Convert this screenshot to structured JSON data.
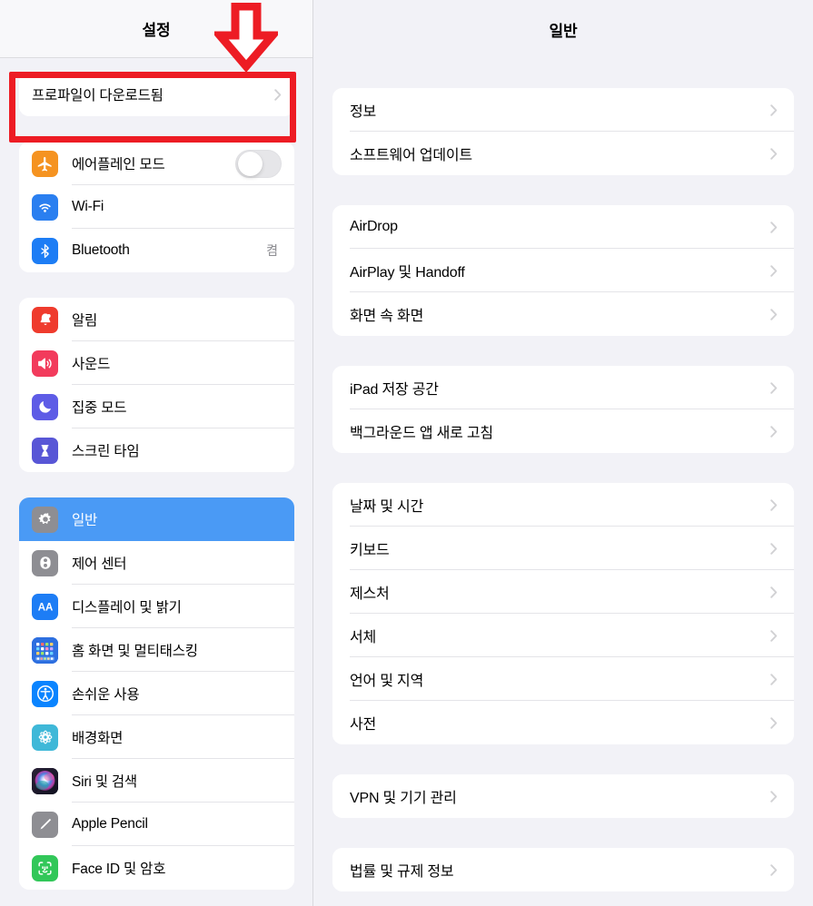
{
  "sidebar": {
    "header_title": "설정",
    "profile_group": [
      {
        "label": "프로파일이 다운로드됨",
        "icon": "none",
        "accessory": "chevron"
      }
    ],
    "groups": [
      {
        "name": "connectivity",
        "rows": [
          {
            "label": "에어플레인 모드",
            "icon": "airplane-icon",
            "icon_color": "#f59321",
            "accessory": "toggle",
            "toggle_on": false
          },
          {
            "label": "Wi-Fi",
            "icon": "wifi-icon",
            "icon_color": "#2a7ff0",
            "accessory": "none"
          },
          {
            "label": "Bluetooth",
            "icon": "bluetooth-icon",
            "icon_color": "#1d7df5",
            "accessory": "value",
            "value": "켬"
          }
        ]
      },
      {
        "name": "alerts",
        "rows": [
          {
            "label": "알림",
            "icon": "bell-icon",
            "icon_color": "#ef3b2d",
            "accessory": "none"
          },
          {
            "label": "사운드",
            "icon": "speaker-icon",
            "icon_color": "#f23b5c",
            "accessory": "none"
          },
          {
            "label": "집중 모드",
            "icon": "moon-icon",
            "icon_color": "#5e5ce6",
            "accessory": "none"
          },
          {
            "label": "스크린 타임",
            "icon": "hourglass-icon",
            "icon_color": "#5856d6",
            "accessory": "none"
          }
        ]
      },
      {
        "name": "system",
        "rows": [
          {
            "label": "일반",
            "icon": "gear-icon",
            "icon_color": "#8e8e93",
            "accessory": "none",
            "selected": true
          },
          {
            "label": "제어 센터",
            "icon": "control-center-icon",
            "icon_color": "#8e8e93",
            "accessory": "none"
          },
          {
            "label": "디스플레이 및 밝기",
            "icon": "display-brightness-icon",
            "icon_color": "#1d7df5",
            "accessory": "none"
          },
          {
            "label": "홈 화면 및 멀티태스킹",
            "icon": "home-screen-icon",
            "icon_color": "#1f5fd0",
            "accessory": "none"
          },
          {
            "label": "손쉬운 사용",
            "icon": "accessibility-icon",
            "icon_color": "#0a84ff",
            "accessory": "none"
          },
          {
            "label": "배경화면",
            "icon": "wallpaper-icon",
            "icon_color": "#3fb8d8",
            "accessory": "none"
          },
          {
            "label": "Siri 및 검색",
            "icon": "siri-icon",
            "icon_color": "#1c1c2e",
            "accessory": "none"
          },
          {
            "label": "Apple Pencil",
            "icon": "apple-pencil-icon",
            "icon_color": "#8e8e93",
            "accessory": "none"
          },
          {
            "label": "Face ID 및 암호",
            "icon": "face-id-icon",
            "icon_color": "#32c759",
            "accessory": "none"
          }
        ]
      }
    ]
  },
  "detail": {
    "header_title": "일반",
    "groups": [
      {
        "name": "about-update",
        "rows": [
          {
            "label": "정보"
          },
          {
            "label": "소프트웨어 업데이트"
          }
        ]
      },
      {
        "name": "sharing",
        "rows": [
          {
            "label": "AirDrop"
          },
          {
            "label": "AirPlay 및 Handoff"
          },
          {
            "label": "화면 속 화면"
          }
        ]
      },
      {
        "name": "storage",
        "rows": [
          {
            "label": "iPad 저장 공간"
          },
          {
            "label": "백그라운드 앱 새로 고침"
          }
        ]
      },
      {
        "name": "input-locale",
        "rows": [
          {
            "label": "날짜 및 시간"
          },
          {
            "label": "키보드"
          },
          {
            "label": "제스처"
          },
          {
            "label": "서체"
          },
          {
            "label": "언어 및 지역"
          },
          {
            "label": "사전"
          }
        ]
      },
      {
        "name": "vpn-device",
        "rows": [
          {
            "label": "VPN 및 기기 관리"
          }
        ]
      },
      {
        "name": "legal",
        "rows": [
          {
            "label": "법률 및 규제 정보"
          }
        ]
      }
    ]
  },
  "annotations": {
    "highlight_color": "#ed1c24",
    "arrow_direction": "down",
    "target": "프로파일이 다운로드됨"
  }
}
